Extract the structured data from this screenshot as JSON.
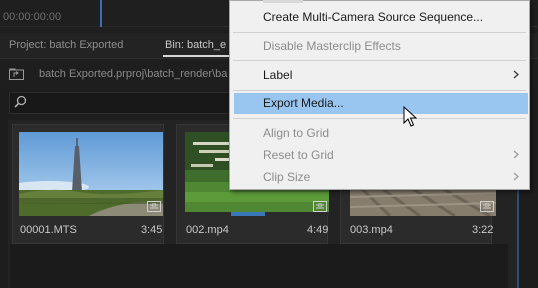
{
  "timecode": "00:00:00:00",
  "tabs": {
    "project": "Project: batch Exported",
    "bin": "Bin: batch_e"
  },
  "path": "batch Exported.prproj\\batch_render\\ba",
  "clips": [
    {
      "name": "00001.MTS",
      "duration": "3:45"
    },
    {
      "name": "002.mp4",
      "duration": "4:49"
    },
    {
      "name": "003.mp4",
      "duration": "3:22"
    }
  ],
  "menu": {
    "items": [
      {
        "label": "Create Multi-Camera Source Sequence...",
        "disabled": false,
        "submenu": false
      },
      {
        "label": "Disable Masterclip Effects",
        "disabled": true,
        "submenu": false
      },
      {
        "label": "Label",
        "disabled": false,
        "submenu": true
      },
      {
        "label": "Export Media...",
        "disabled": false,
        "submenu": false,
        "highlighted": true
      },
      {
        "label": "Align to Grid",
        "disabled": true,
        "submenu": false
      },
      {
        "label": "Reset to Grid",
        "disabled": true,
        "submenu": true
      },
      {
        "label": "Clip Size",
        "disabled": true,
        "submenu": true
      }
    ]
  },
  "colors": {
    "highlight": "#98c6f0",
    "menu_bg": "#f0f0f0",
    "panel_bg": "#1d1d1d"
  },
  "icons": [
    "up-folder-icon",
    "search-icon",
    "clip-badge-icon",
    "submenu-arrow-icon",
    "mouse-cursor-icon"
  ]
}
